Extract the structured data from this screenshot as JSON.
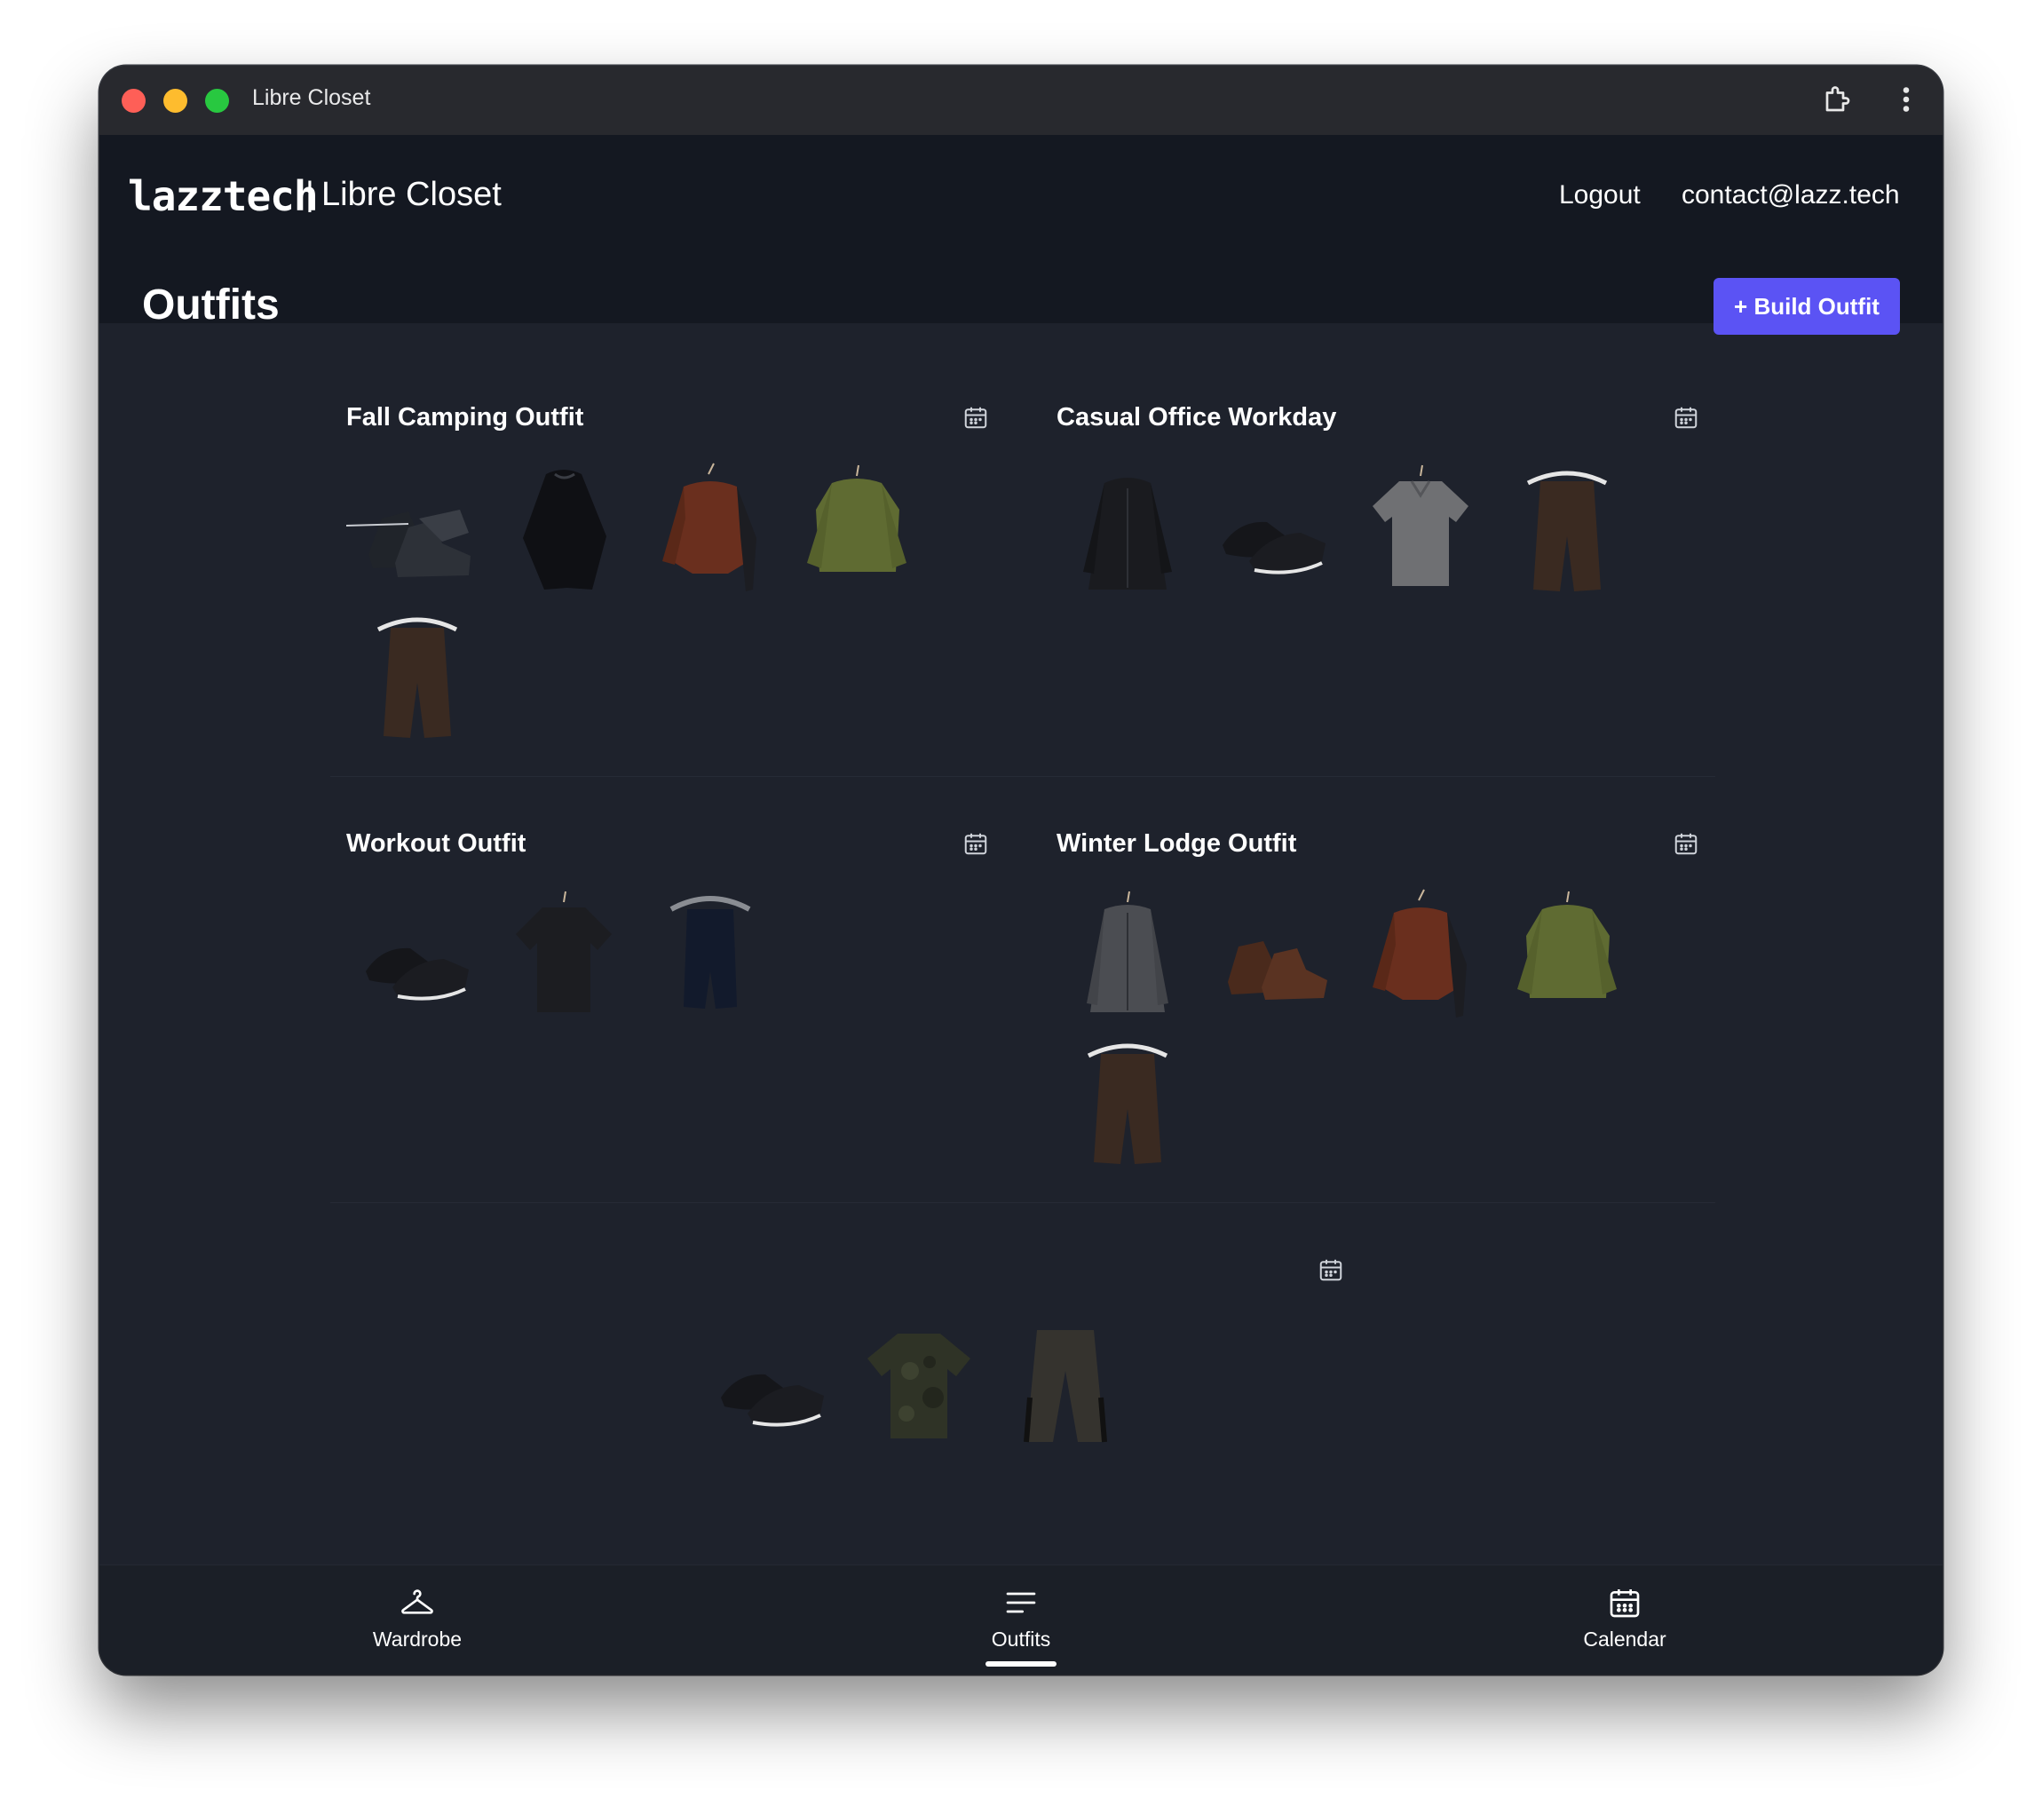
{
  "window": {
    "title": "Libre Closet"
  },
  "header": {
    "logo_text": "lazztech",
    "separator": "|",
    "app_name": "Libre Closet",
    "nav": {
      "logout": "Logout",
      "email": "contact@lazz.tech"
    }
  },
  "page": {
    "title": "Outfits",
    "build_button": "+ Build Outfit"
  },
  "outfits": [
    {
      "name": "Fall Camping Outfit",
      "items": [
        "hiking-boots",
        "black-poncho",
        "rust-fleece-jacket",
        "olive-sweater",
        "brown-pants"
      ]
    },
    {
      "name": "Casual Office Workday",
      "items": [
        "black-leather-jacket",
        "black-sneakers",
        "gray-polo-shirt",
        "brown-pants"
      ]
    },
    {
      "name": "Workout Outfit",
      "items": [
        "black-sneakers",
        "black-tshirt",
        "navy-shorts"
      ]
    },
    {
      "name": "Winter Lodge Outfit",
      "items": [
        "gray-jacket",
        "brown-boots",
        "rust-fleece-jacket",
        "olive-sweater",
        "brown-pants"
      ]
    },
    {
      "name": "",
      "items": [
        "black-sneakers",
        "camo-tshirt",
        "gray-track-pants"
      ]
    }
  ],
  "bottom_nav": [
    {
      "label": "Wardrobe",
      "icon": "hanger-icon"
    },
    {
      "label": "Outfits",
      "icon": "list-icon",
      "active": true
    },
    {
      "label": "Calendar",
      "icon": "calendar-icon"
    }
  ],
  "colors": {
    "accent": "#5b53f4",
    "background": "#1e222c",
    "header": "#141821",
    "titlebar": "#28292e"
  }
}
